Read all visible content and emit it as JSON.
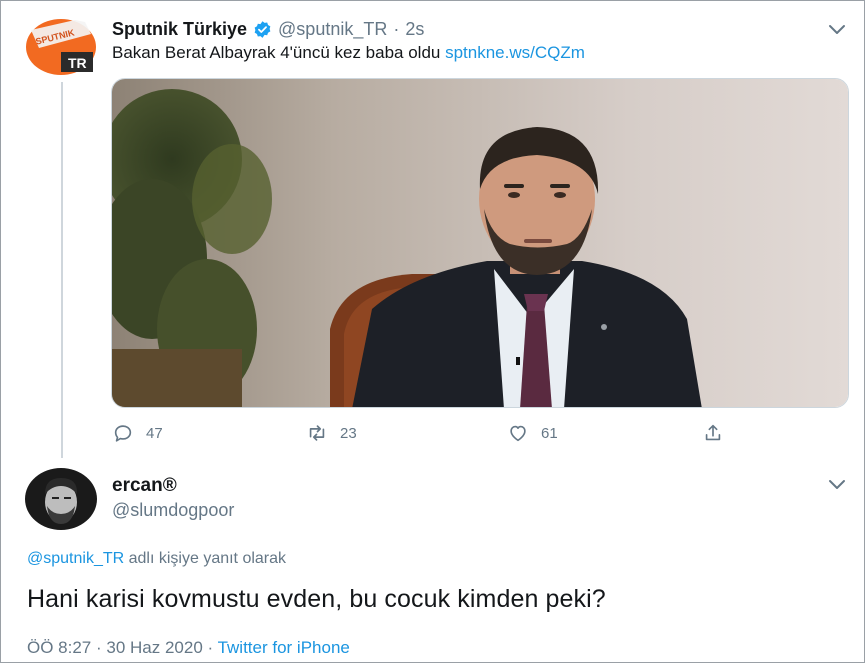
{
  "tweet": {
    "display_name": "Sputnik Türkiye",
    "verified_icon": "verified-badge-icon",
    "handle": "@sputnik_TR",
    "separator": "·",
    "time": "2s",
    "avatar_logo_text": "SPUTNIK",
    "avatar_region_text": "TR",
    "text": "Bakan Berat Albayrak 4'üncü kez baba oldu ",
    "link": "sptnkne.ws/CQZm",
    "actions": {
      "replies": "47",
      "retweets": "23",
      "likes": "61"
    }
  },
  "reply": {
    "display_name": "ercan®",
    "handle": "@slumdogpoor",
    "reply_to_mention": "@sputnik_TR",
    "reply_to_suffix": " adlı kişiye yanıt olarak",
    "text": "Hani karisi kovmustu evden, bu cocuk kimden peki?",
    "timestamp": "ÖÖ 8:27 · 30 Haz 2020 · ",
    "source": "Twitter for iPhone"
  },
  "colors": {
    "link": "#1b95e0",
    "secondary_text": "#657786",
    "primary_text": "#14171a",
    "brand_orange": "#f26a21"
  }
}
